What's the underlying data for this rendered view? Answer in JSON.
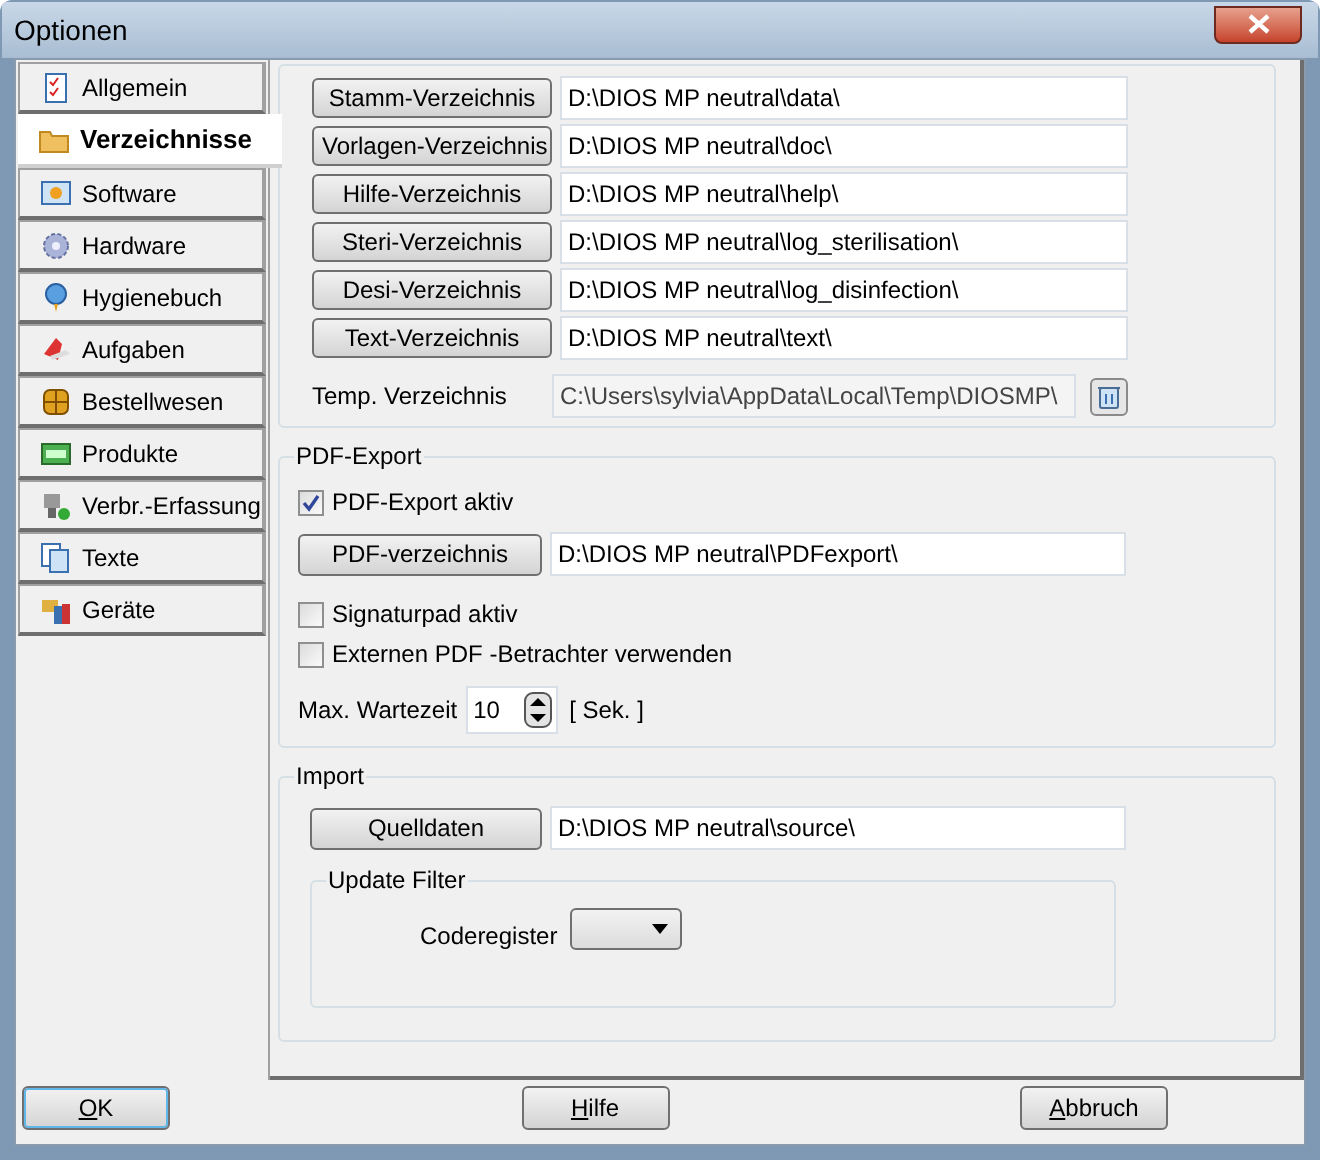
{
  "window": {
    "title": "Optionen"
  },
  "tabs": [
    {
      "label": "Allgemein",
      "selected": false
    },
    {
      "label": "Verzeichnisse",
      "selected": true
    },
    {
      "label": "Software",
      "selected": false
    },
    {
      "label": "Hardware",
      "selected": false
    },
    {
      "label": "Hygienebuch",
      "selected": false
    },
    {
      "label": "Aufgaben",
      "selected": false
    },
    {
      "label": "Bestellwesen",
      "selected": false
    },
    {
      "label": "Produkte",
      "selected": false
    },
    {
      "label": "Verbr.-Erfassung",
      "selected": false
    },
    {
      "label": "Texte",
      "selected": false
    },
    {
      "label": "Geräte",
      "selected": false
    }
  ],
  "directories": [
    {
      "button": "Stamm-Verzeichnis",
      "value": "D:\\DIOS MP neutral\\data\\"
    },
    {
      "button": "Vorlagen-Verzeichnis",
      "value": "D:\\DIOS MP neutral\\doc\\"
    },
    {
      "button": "Hilfe-Verzeichnis",
      "value": "D:\\DIOS MP neutral\\help\\"
    },
    {
      "button": "Steri-Verzeichnis",
      "value": "D:\\DIOS MP neutral\\log_sterilisation\\"
    },
    {
      "button": "Desi-Verzeichnis",
      "value": "D:\\DIOS MP neutral\\log_disinfection\\"
    },
    {
      "button": "Text-Verzeichnis",
      "value": "D:\\DIOS MP neutral\\text\\"
    }
  ],
  "temp": {
    "label": "Temp. Verzeichnis",
    "value": "C:\\Users\\sylvia\\AppData\\Local\\Temp\\DIOSMP\\",
    "disabled": true
  },
  "pdf_export": {
    "title": "PDF-Export",
    "checkbox_active": {
      "label": "PDF-Export aktiv",
      "checked": true
    },
    "button": "PDF-verzeichnis",
    "value": "D:\\DIOS MP neutral\\PDFexport\\",
    "checkbox_signature": {
      "label": "Signaturpad aktiv",
      "checked": false
    },
    "checkbox_viewer": {
      "label": "Externen PDF -Betrachter verwenden",
      "checked": false
    },
    "wait_label": "Max. Wartezeit",
    "wait_value": "10",
    "wait_unit": "[ Sek. ]"
  },
  "import": {
    "title": "Import",
    "button": "Quelldaten",
    "value": "D:\\DIOS MP neutral\\source\\",
    "filter": {
      "title": "Update Filter",
      "label": "Coderegister"
    }
  },
  "buttons": [
    {
      "label": "OK",
      "default": true
    },
    {
      "label": "Hilfe",
      "default": false
    },
    {
      "label": "Abbruch",
      "default": false
    }
  ]
}
